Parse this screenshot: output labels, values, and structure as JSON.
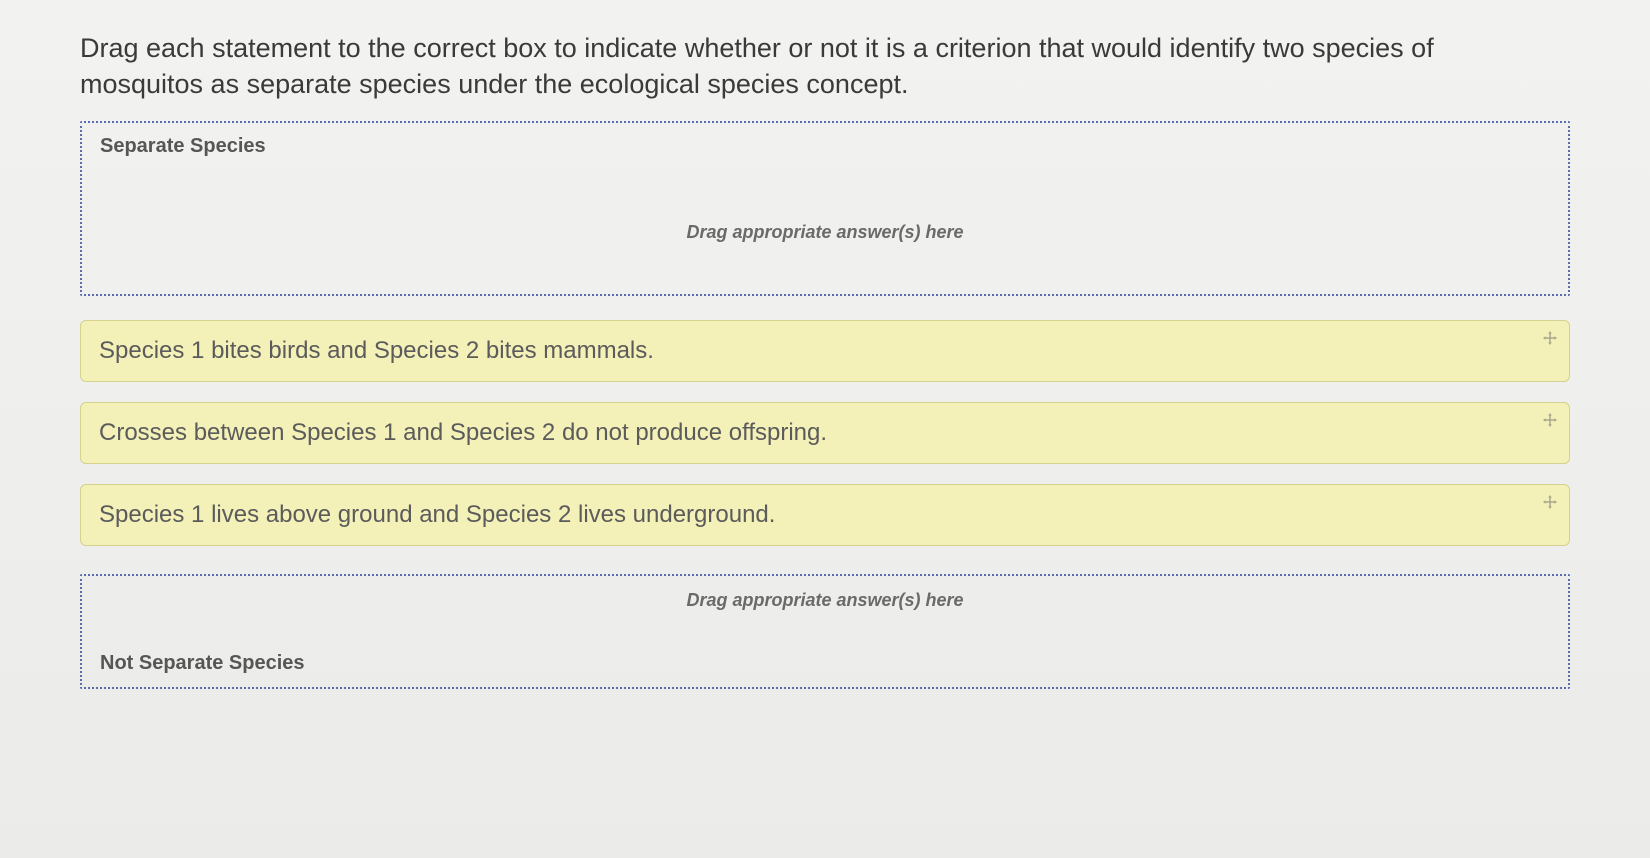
{
  "instructions": "Drag each statement to the correct box to indicate whether or not it is a criterion that would identify two species of mosquitos as separate species under the ecological species concept.",
  "zones": {
    "separate": {
      "label": "Separate Species",
      "hint": "Drag appropriate answer(s) here"
    },
    "not_separate": {
      "label": "Not Separate Species",
      "hint": "Drag appropriate answer(s) here"
    }
  },
  "statements": {
    "s1": "Species 1 bites birds and Species 2 bites mammals.",
    "s2": "Crosses between Species 1 and Species 2 do not produce offspring.",
    "s3": "Species 1 lives above ground and Species 2 lives underground."
  }
}
